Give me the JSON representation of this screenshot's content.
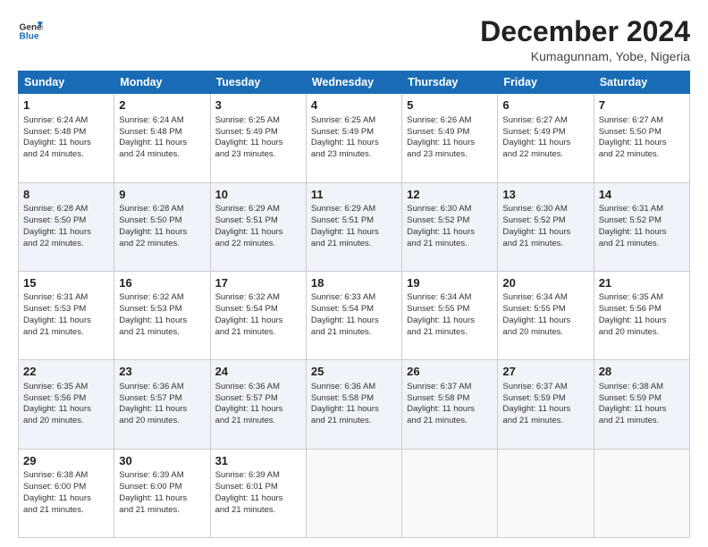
{
  "header": {
    "logo_line1": "General",
    "logo_line2": "Blue",
    "month_title": "December 2024",
    "location": "Kumagunnam, Yobe, Nigeria"
  },
  "days_of_week": [
    "Sunday",
    "Monday",
    "Tuesday",
    "Wednesday",
    "Thursday",
    "Friday",
    "Saturday"
  ],
  "weeks": [
    [
      {
        "day": "1",
        "lines": [
          "Sunrise: 6:24 AM",
          "Sunset: 5:48 PM",
          "Daylight: 11 hours",
          "and 24 minutes."
        ]
      },
      {
        "day": "2",
        "lines": [
          "Sunrise: 6:24 AM",
          "Sunset: 5:48 PM",
          "Daylight: 11 hours",
          "and 24 minutes."
        ]
      },
      {
        "day": "3",
        "lines": [
          "Sunrise: 6:25 AM",
          "Sunset: 5:49 PM",
          "Daylight: 11 hours",
          "and 23 minutes."
        ]
      },
      {
        "day": "4",
        "lines": [
          "Sunrise: 6:25 AM",
          "Sunset: 5:49 PM",
          "Daylight: 11 hours",
          "and 23 minutes."
        ]
      },
      {
        "day": "5",
        "lines": [
          "Sunrise: 6:26 AM",
          "Sunset: 5:49 PM",
          "Daylight: 11 hours",
          "and 23 minutes."
        ]
      },
      {
        "day": "6",
        "lines": [
          "Sunrise: 6:27 AM",
          "Sunset: 5:49 PM",
          "Daylight: 11 hours",
          "and 22 minutes."
        ]
      },
      {
        "day": "7",
        "lines": [
          "Sunrise: 6:27 AM",
          "Sunset: 5:50 PM",
          "Daylight: 11 hours",
          "and 22 minutes."
        ]
      }
    ],
    [
      {
        "day": "8",
        "lines": [
          "Sunrise: 6:28 AM",
          "Sunset: 5:50 PM",
          "Daylight: 11 hours",
          "and 22 minutes."
        ]
      },
      {
        "day": "9",
        "lines": [
          "Sunrise: 6:28 AM",
          "Sunset: 5:50 PM",
          "Daylight: 11 hours",
          "and 22 minutes."
        ]
      },
      {
        "day": "10",
        "lines": [
          "Sunrise: 6:29 AM",
          "Sunset: 5:51 PM",
          "Daylight: 11 hours",
          "and 22 minutes."
        ]
      },
      {
        "day": "11",
        "lines": [
          "Sunrise: 6:29 AM",
          "Sunset: 5:51 PM",
          "Daylight: 11 hours",
          "and 21 minutes."
        ]
      },
      {
        "day": "12",
        "lines": [
          "Sunrise: 6:30 AM",
          "Sunset: 5:52 PM",
          "Daylight: 11 hours",
          "and 21 minutes."
        ]
      },
      {
        "day": "13",
        "lines": [
          "Sunrise: 6:30 AM",
          "Sunset: 5:52 PM",
          "Daylight: 11 hours",
          "and 21 minutes."
        ]
      },
      {
        "day": "14",
        "lines": [
          "Sunrise: 6:31 AM",
          "Sunset: 5:52 PM",
          "Daylight: 11 hours",
          "and 21 minutes."
        ]
      }
    ],
    [
      {
        "day": "15",
        "lines": [
          "Sunrise: 6:31 AM",
          "Sunset: 5:53 PM",
          "Daylight: 11 hours",
          "and 21 minutes."
        ]
      },
      {
        "day": "16",
        "lines": [
          "Sunrise: 6:32 AM",
          "Sunset: 5:53 PM",
          "Daylight: 11 hours",
          "and 21 minutes."
        ]
      },
      {
        "day": "17",
        "lines": [
          "Sunrise: 6:32 AM",
          "Sunset: 5:54 PM",
          "Daylight: 11 hours",
          "and 21 minutes."
        ]
      },
      {
        "day": "18",
        "lines": [
          "Sunrise: 6:33 AM",
          "Sunset: 5:54 PM",
          "Daylight: 11 hours",
          "and 21 minutes."
        ]
      },
      {
        "day": "19",
        "lines": [
          "Sunrise: 6:34 AM",
          "Sunset: 5:55 PM",
          "Daylight: 11 hours",
          "and 21 minutes."
        ]
      },
      {
        "day": "20",
        "lines": [
          "Sunrise: 6:34 AM",
          "Sunset: 5:55 PM",
          "Daylight: 11 hours",
          "and 20 minutes."
        ]
      },
      {
        "day": "21",
        "lines": [
          "Sunrise: 6:35 AM",
          "Sunset: 5:56 PM",
          "Daylight: 11 hours",
          "and 20 minutes."
        ]
      }
    ],
    [
      {
        "day": "22",
        "lines": [
          "Sunrise: 6:35 AM",
          "Sunset: 5:56 PM",
          "Daylight: 11 hours",
          "and 20 minutes."
        ]
      },
      {
        "day": "23",
        "lines": [
          "Sunrise: 6:36 AM",
          "Sunset: 5:57 PM",
          "Daylight: 11 hours",
          "and 20 minutes."
        ]
      },
      {
        "day": "24",
        "lines": [
          "Sunrise: 6:36 AM",
          "Sunset: 5:57 PM",
          "Daylight: 11 hours",
          "and 21 minutes."
        ]
      },
      {
        "day": "25",
        "lines": [
          "Sunrise: 6:36 AM",
          "Sunset: 5:58 PM",
          "Daylight: 11 hours",
          "and 21 minutes."
        ]
      },
      {
        "day": "26",
        "lines": [
          "Sunrise: 6:37 AM",
          "Sunset: 5:58 PM",
          "Daylight: 11 hours",
          "and 21 minutes."
        ]
      },
      {
        "day": "27",
        "lines": [
          "Sunrise: 6:37 AM",
          "Sunset: 5:59 PM",
          "Daylight: 11 hours",
          "and 21 minutes."
        ]
      },
      {
        "day": "28",
        "lines": [
          "Sunrise: 6:38 AM",
          "Sunset: 5:59 PM",
          "Daylight: 11 hours",
          "and 21 minutes."
        ]
      }
    ],
    [
      {
        "day": "29",
        "lines": [
          "Sunrise: 6:38 AM",
          "Sunset: 6:00 PM",
          "Daylight: 11 hours",
          "and 21 minutes."
        ]
      },
      {
        "day": "30",
        "lines": [
          "Sunrise: 6:39 AM",
          "Sunset: 6:00 PM",
          "Daylight: 11 hours",
          "and 21 minutes."
        ]
      },
      {
        "day": "31",
        "lines": [
          "Sunrise: 6:39 AM",
          "Sunset: 6:01 PM",
          "Daylight: 11 hours",
          "and 21 minutes."
        ]
      },
      null,
      null,
      null,
      null
    ]
  ]
}
